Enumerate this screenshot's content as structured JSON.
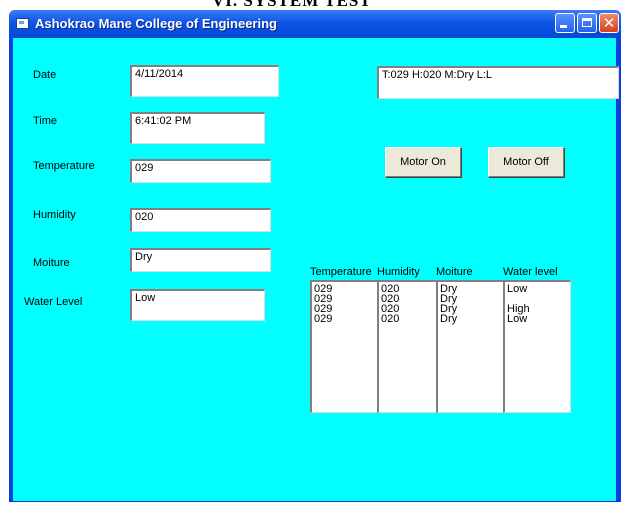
{
  "document": {
    "heading": "VI.     SYSTEM TEST"
  },
  "window": {
    "title": "Ashokrao Mane College of Engineering"
  },
  "fields": {
    "date": {
      "label": "Date",
      "value": "4/11/2014"
    },
    "time": {
      "label": "Time",
      "value": "6:41:02 PM"
    },
    "temperature": {
      "label": "Temperature",
      "value": "029"
    },
    "humidity": {
      "label": "Humidity",
      "value": "020"
    },
    "moisture": {
      "label": "Moiture",
      "value": "Dry"
    },
    "water_level": {
      "label": "Water Level",
      "value": "Low"
    }
  },
  "status": {
    "value": "T:029 H:020 M:Dry L:L"
  },
  "buttons": {
    "motor_on": "Motor On",
    "motor_off": "Motor Off"
  },
  "log": {
    "headers": [
      "Temperature",
      "Humidity",
      "Moiture",
      "Water level"
    ],
    "temperature": [
      "029",
      "029",
      "029",
      "029"
    ],
    "humidity": [
      "020",
      "020",
      "020",
      "020"
    ],
    "moisture": [
      "Dry",
      "Dry",
      "Dry",
      "Dry"
    ],
    "water_level": [
      "Low",
      "",
      "High",
      "Low"
    ]
  }
}
